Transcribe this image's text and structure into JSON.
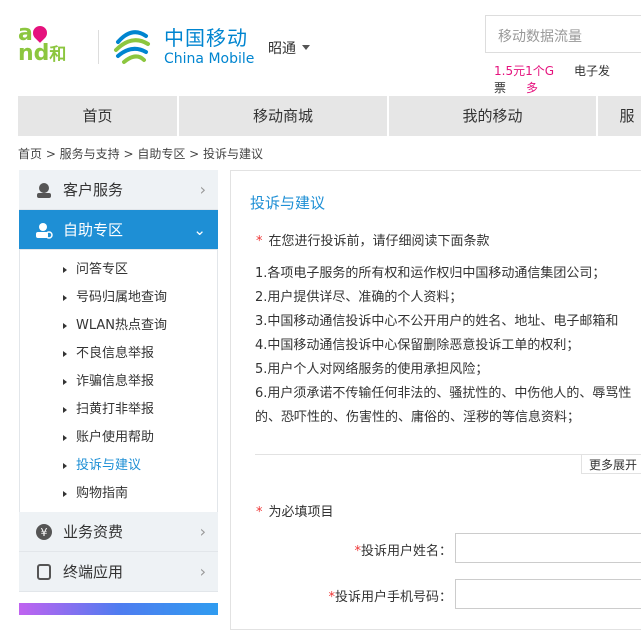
{
  "header": {
    "and_logo": "and和",
    "brand_cn": "中国移动",
    "brand_en": "China Mobile",
    "city": "昭通",
    "search_placeholder": "移动数据流量",
    "links": [
      "1.5元1个G",
      "电子发票",
      "多"
    ],
    "accent": "#e5127d"
  },
  "nav": [
    "首页",
    "移动商城",
    "我的移动",
    "服"
  ],
  "breadcrumb": "首页 > 服务与支持 > 自助专区 > 投诉与建议",
  "sidebar": {
    "top": "客户服务",
    "active": "自助专区",
    "sub": [
      "问答专区",
      "号码归属地查询",
      "WLAN热点查询",
      "不良信息举报",
      "诈骗信息举报",
      "扫黄打非举报",
      "账户使用帮助",
      "投诉与建议",
      "购物指南"
    ],
    "bottom": [
      "业务资费",
      "终端应用"
    ]
  },
  "content": {
    "title": "投诉与建议",
    "notice": "在您进行投诉前，请仔细阅读下面条款",
    "terms": [
      "1.各项电子服务的所有权和运作权归中国移动通信集团公司；",
      "2.用户提供详尽、准确的个人资料；",
      "3.中国移动通信投诉中心不公开用户的姓名、地址、电子邮箱和",
      "4.中国移动通信投诉中心保留删除恶意投诉工单的权利；",
      "5.用户个人对网络服务的使用承担风险；",
      "6.用户须承诺不传输任何非法的、骚扰性的、中伤他人的、辱骂性的、恐吓性的、伤害性的、庸俗的、淫秽的等信息资料；"
    ],
    "more": "更多展开",
    "required_note": "为必填项目",
    "star": "*",
    "fields": [
      {
        "label": "投诉用户姓名：",
        "value": ""
      },
      {
        "label": "投诉用户手机号码：",
        "value": ""
      }
    ]
  }
}
